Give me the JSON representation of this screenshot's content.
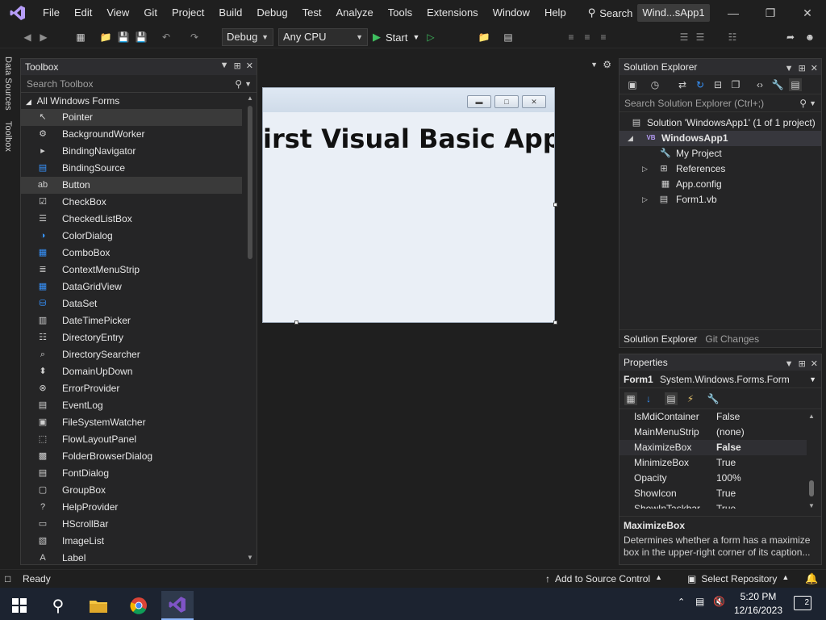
{
  "menu": {
    "items": [
      "File",
      "Edit",
      "View",
      "Git",
      "Project",
      "Build",
      "Debug",
      "Test",
      "Analyze",
      "Tools",
      "Extensions",
      "Window",
      "Help"
    ],
    "search_label": "Search",
    "window_title": "Wind...sApp1"
  },
  "toolbar": {
    "config": "Debug",
    "platform": "Any CPU",
    "start_label": "Start"
  },
  "side_tabs": [
    "Data Sources",
    "Toolbox"
  ],
  "toolbox": {
    "title": "Toolbox",
    "search_placeholder": "Search Toolbox",
    "group_label": "All Windows Forms",
    "items": [
      {
        "label": "Pointer",
        "icon": "pointer-icon"
      },
      {
        "label": "BackgroundWorker",
        "icon": "background-worker-icon"
      },
      {
        "label": "BindingNavigator",
        "icon": "binding-navigator-icon"
      },
      {
        "label": "BindingSource",
        "icon": "binding-source-icon"
      },
      {
        "label": "Button",
        "icon": "button-icon"
      },
      {
        "label": "CheckBox",
        "icon": "checkbox-icon"
      },
      {
        "label": "CheckedListBox",
        "icon": "checked-list-box-icon"
      },
      {
        "label": "ColorDialog",
        "icon": "color-dialog-icon"
      },
      {
        "label": "ComboBox",
        "icon": "combobox-icon"
      },
      {
        "label": "ContextMenuStrip",
        "icon": "context-menu-strip-icon"
      },
      {
        "label": "DataGridView",
        "icon": "data-grid-view-icon"
      },
      {
        "label": "DataSet",
        "icon": "dataset-icon"
      },
      {
        "label": "DateTimePicker",
        "icon": "date-time-picker-icon"
      },
      {
        "label": "DirectoryEntry",
        "icon": "directory-entry-icon"
      },
      {
        "label": "DirectorySearcher",
        "icon": "directory-searcher-icon"
      },
      {
        "label": "DomainUpDown",
        "icon": "domain-up-down-icon"
      },
      {
        "label": "ErrorProvider",
        "icon": "error-provider-icon"
      },
      {
        "label": "EventLog",
        "icon": "event-log-icon"
      },
      {
        "label": "FileSystemWatcher",
        "icon": "file-system-watcher-icon"
      },
      {
        "label": "FlowLayoutPanel",
        "icon": "flow-layout-panel-icon"
      },
      {
        "label": "FolderBrowserDialog",
        "icon": "folder-browser-dialog-icon"
      },
      {
        "label": "FontDialog",
        "icon": "font-dialog-icon"
      },
      {
        "label": "GroupBox",
        "icon": "group-box-icon"
      },
      {
        "label": "HelpProvider",
        "icon": "help-provider-icon"
      },
      {
        "label": "HScrollBar",
        "icon": "hscrollbar-icon"
      },
      {
        "label": "ImageList",
        "icon": "image-list-icon"
      },
      {
        "label": "Label",
        "icon": "label-icon"
      }
    ]
  },
  "designer": {
    "form_label": "irst Visual Basic App!"
  },
  "solution_explorer": {
    "title": "Solution Explorer",
    "search_placeholder": "Search Solution Explorer (Ctrl+;)",
    "solution": "Solution 'WindowsApp1' (1 of 1 project)",
    "project": "WindowsApp1",
    "items": [
      "My Project",
      "References",
      "App.config",
      "Form1.vb"
    ],
    "tabs": [
      "Solution Explorer",
      "Git Changes"
    ]
  },
  "properties": {
    "title": "Properties",
    "object_name": "Form1",
    "object_type": "System.Windows.Forms.Form",
    "rows": [
      {
        "name": "IsMdiContainer",
        "value": "False"
      },
      {
        "name": "MainMenuStrip",
        "value": "(none)"
      },
      {
        "name": "MaximizeBox",
        "value": "False"
      },
      {
        "name": "MinimizeBox",
        "value": "True"
      },
      {
        "name": "Opacity",
        "value": "100%"
      },
      {
        "name": "ShowIcon",
        "value": "True"
      },
      {
        "name": "ShowInTaskbar",
        "value": "True"
      }
    ],
    "desc_title": "MaximizeBox",
    "desc_text": "Determines whether a form has a maximize box in the upper-right corner of its caption..."
  },
  "statusbar": {
    "ready": "Ready",
    "source_control": "Add to Source Control",
    "repository": "Select Repository"
  },
  "taskbar": {
    "time": "5:20 PM",
    "date": "12/16/2023",
    "notifications": "2"
  },
  "colors": {
    "vs_purple": "#7f54c6",
    "accent_blue": "#3794ff",
    "start_green": "#3fbf5f"
  }
}
